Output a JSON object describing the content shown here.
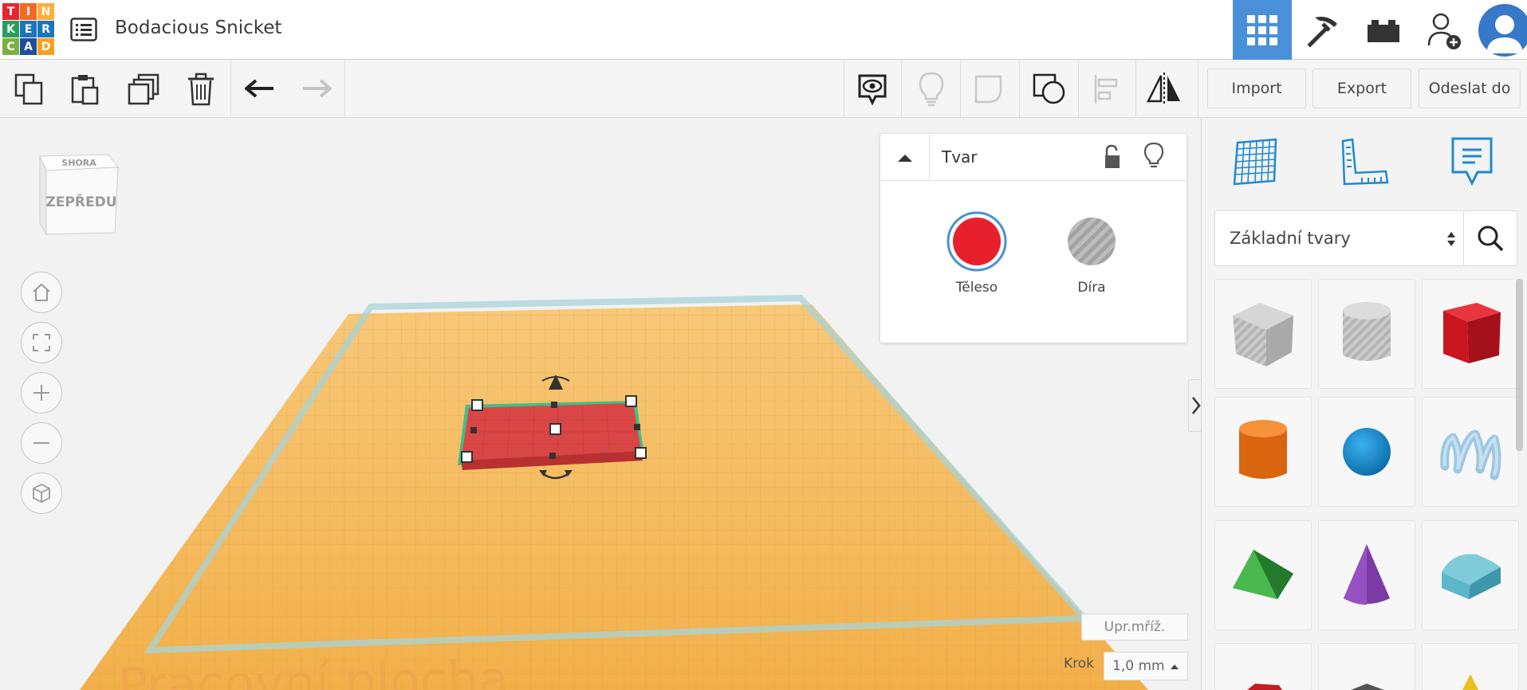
{
  "logo": {
    "letters": [
      "T",
      "I",
      "N",
      "K",
      "E",
      "R",
      "C",
      "A",
      "D"
    ]
  },
  "design": {
    "title": "Bodacious Snicket"
  },
  "topnav": {
    "icons": [
      "3d-design-grid-icon",
      "pickaxe-icon",
      "bricks-icon",
      "add-user-icon",
      "user-avatar"
    ]
  },
  "toolbar": {
    "left_icons": [
      "copy-icon",
      "paste-icon",
      "duplicate-icon",
      "delete-icon",
      "undo-icon",
      "redo-icon"
    ],
    "right_icons": [
      "show-all-icon",
      "lightbulb-icon",
      "group-icon",
      "ungroup-icon",
      "align-icon",
      "mirror-icon"
    ],
    "import_label": "Import",
    "export_label": "Export",
    "send_label": "Odeslat do"
  },
  "viewcube": {
    "top_label": "SHORA",
    "front_label": "ZEPŘEDU"
  },
  "inspector": {
    "title": "Tvar",
    "solid_label": "Těleso",
    "hole_label": "Díra",
    "solid_color": "#e8202e"
  },
  "workplane": {
    "watermark": "Pracovní plocha",
    "grid_settings_label": "Upr.mříž.",
    "snap_label": "Krok",
    "snap_value": "1,0 mm"
  },
  "library": {
    "selected": "Základní tvary",
    "shapes": [
      "box-hole",
      "cylinder-hole",
      "box",
      "cylinder",
      "sphere",
      "scribble",
      "roof",
      "cone",
      "round-roof"
    ]
  },
  "colors": {
    "accent": "#4a90d9",
    "workplane": "#f5b754",
    "shape": "#d94a4a"
  }
}
